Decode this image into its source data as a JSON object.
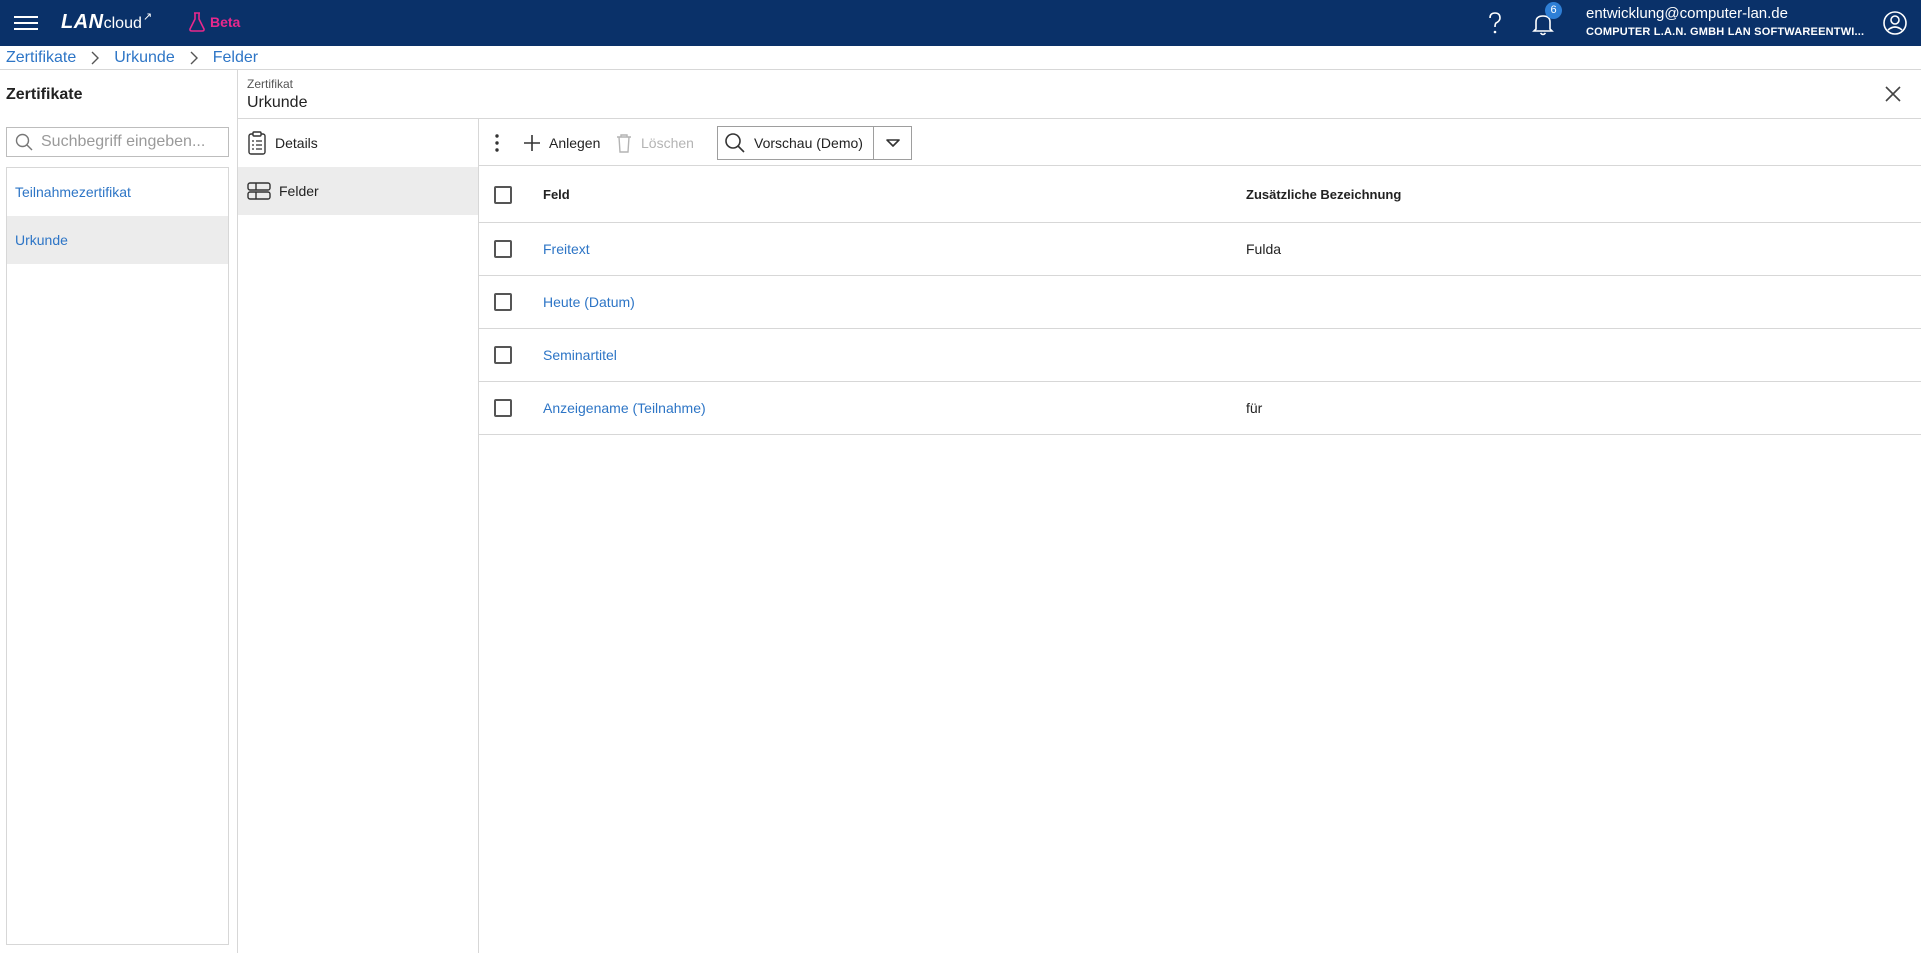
{
  "topbar": {
    "logo_lan": "LAN",
    "logo_cloud": "cloud",
    "beta_label": "Beta",
    "notification_count": "6",
    "user_email": "entwicklung@computer-lan.de",
    "user_org": "COMPUTER L.A.N. GMBH LAN SOFTWAREENTWI..."
  },
  "breadcrumb": [
    {
      "label": "Zertifikate"
    },
    {
      "label": "Urkunde"
    },
    {
      "label": "Felder"
    }
  ],
  "left_panel": {
    "title": "Zertifikate",
    "search_placeholder": "Suchbegriff eingeben...",
    "items": [
      {
        "label": "Teilnahmezertifikat"
      },
      {
        "label": "Urkunde"
      }
    ]
  },
  "detail": {
    "subtitle": "Zertifikat",
    "title": "Urkunde"
  },
  "mid_nav": {
    "items": [
      {
        "label": "Details",
        "icon": "clipboard-icon"
      },
      {
        "label": "Felder",
        "icon": "fields-icon"
      }
    ]
  },
  "toolbar": {
    "add_label": "Anlegen",
    "delete_label": "Löschen",
    "preview_label": "Vorschau (Demo)"
  },
  "table": {
    "columns": [
      "Feld",
      "Zusätzliche Bezeichnung"
    ],
    "rows": [
      {
        "feld": "Freitext",
        "zusatz": "Fulda"
      },
      {
        "feld": "Heute (Datum)",
        "zusatz": ""
      },
      {
        "feld": "Seminartitel",
        "zusatz": ""
      },
      {
        "feld": "Anzeigename (Teilnahme)",
        "zusatz": "für"
      }
    ]
  },
  "colors": {
    "topbar_bg": "#0a3169",
    "link": "#2d75c6",
    "beta": "#e8288c",
    "badge": "#2e7fd6",
    "active_bg": "#ececec"
  }
}
